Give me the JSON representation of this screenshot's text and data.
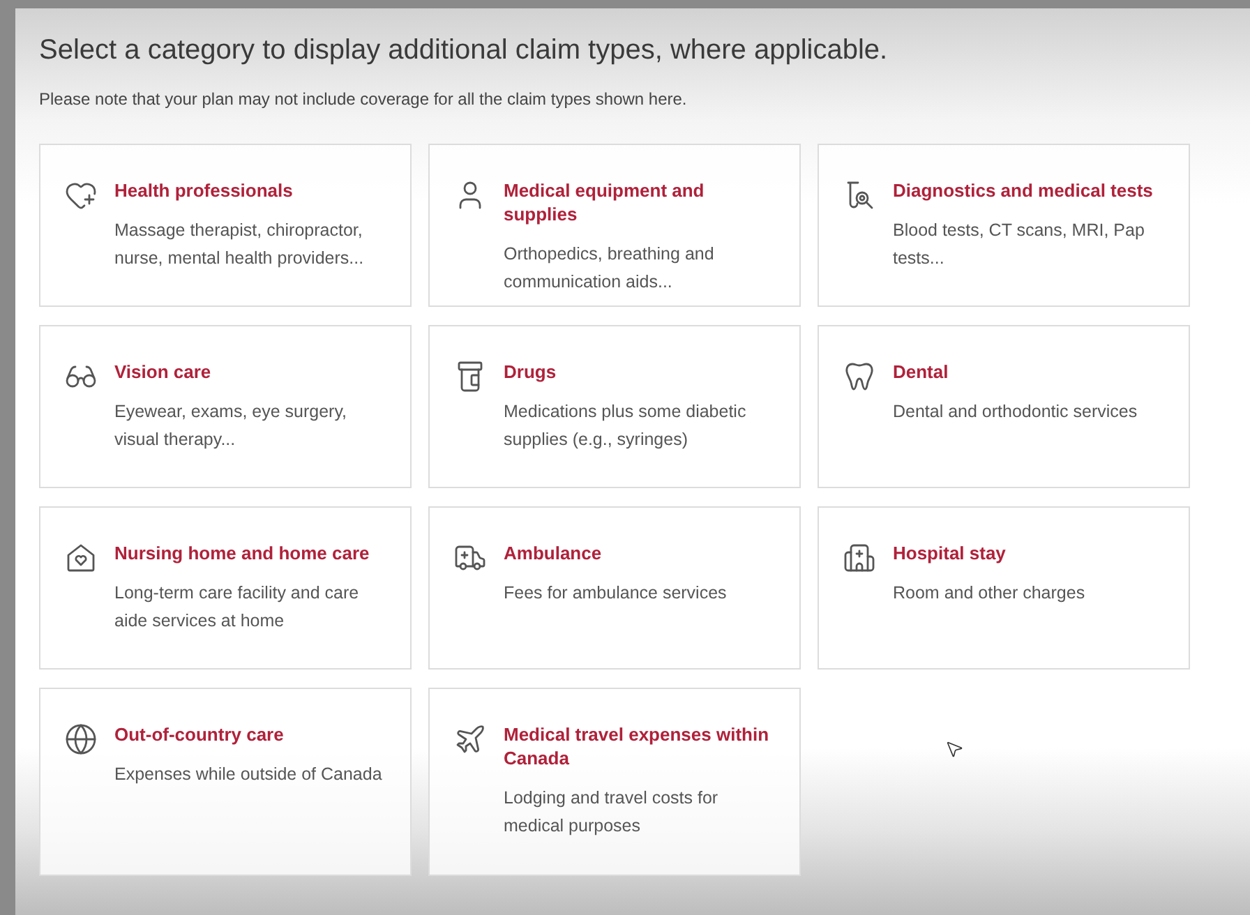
{
  "heading": "Select a category to display additional claim types, where applicable.",
  "note": "Please note that your plan may not include coverage for all the claim types shown here.",
  "categories": [
    {
      "kind": "heart-plus",
      "title": "Health professionals",
      "description": "Massage therapist, chiropractor, nurse, mental health providers..."
    },
    {
      "kind": "person",
      "title": "Medical equipment and supplies",
      "description": "Orthopedics, breathing and communication aids..."
    },
    {
      "kind": "test-tube",
      "title": "Diagnostics and medical tests",
      "description": "Blood tests, CT scans, MRI, Pap tests..."
    },
    {
      "kind": "glasses",
      "title": "Vision care",
      "description": "Eyewear, exams, eye surgery, visual therapy..."
    },
    {
      "kind": "pill-bottle",
      "title": "Drugs",
      "description": "Medications plus some diabetic supplies (e.g., syringes)"
    },
    {
      "kind": "tooth",
      "title": "Dental",
      "description": "Dental and orthodontic services"
    },
    {
      "kind": "house-heart",
      "title": "Nursing home and home care",
      "description": "Long-term care facility and care aide services at home"
    },
    {
      "kind": "ambulance",
      "title": "Ambulance",
      "description": "Fees for ambulance services"
    },
    {
      "kind": "hospital",
      "title": "Hospital stay",
      "description": "Room and other charges"
    },
    {
      "kind": "globe",
      "title": "Out-of-country care",
      "description": "Expenses while outside of Canada"
    },
    {
      "kind": "plane",
      "title": "Medical travel expenses within Canada",
      "description": "Lodging and travel costs for medical purposes"
    }
  ]
}
